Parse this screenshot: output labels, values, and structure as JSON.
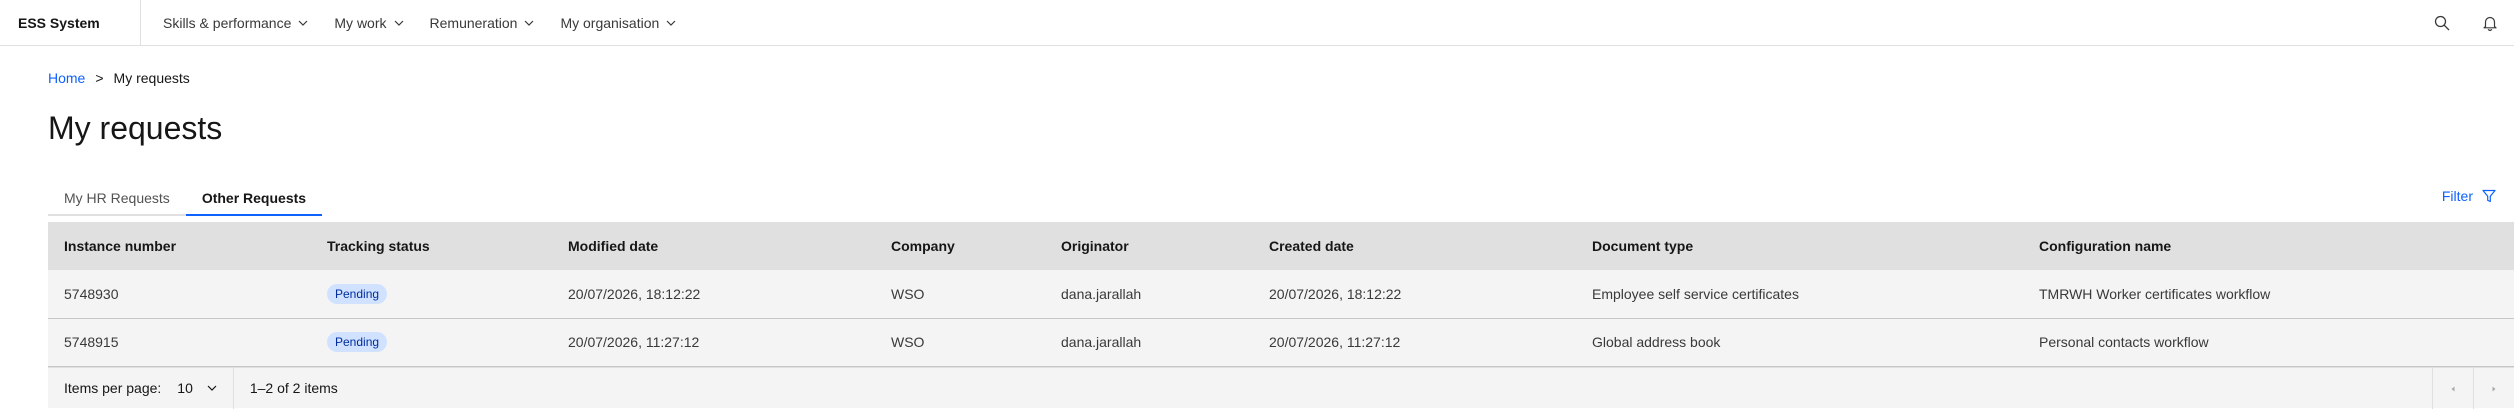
{
  "header": {
    "brand": "ESS System",
    "nav": [
      {
        "label": "Skills & performance"
      },
      {
        "label": "My work"
      },
      {
        "label": "Remuneration"
      },
      {
        "label": "My organisation"
      }
    ],
    "icons": {
      "search": "search-icon",
      "notifications": "bell-icon"
    }
  },
  "breadcrumb": {
    "home": "Home",
    "separator": ">",
    "current": "My requests"
  },
  "page": {
    "title": "My requests"
  },
  "tabs": [
    {
      "label": "My HR Requests",
      "active": false
    },
    {
      "label": "Other Requests",
      "active": true
    }
  ],
  "filter": {
    "label": "Filter"
  },
  "table": {
    "columns": [
      "Instance number",
      "Tracking status",
      "Modified date",
      "Company",
      "Originator",
      "Created date",
      "Document type",
      "Configuration name"
    ],
    "rows": [
      {
        "instance": "5748930",
        "status": "Pending",
        "modified": "20/07/2026, 18:12:22",
        "company": "WSO",
        "originator": "dana.jarallah",
        "created": "20/07/2026, 18:12:22",
        "doctype": "Employee self service certificates",
        "config": "TMRWH Worker certificates workflow"
      },
      {
        "instance": "5748915",
        "status": "Pending",
        "modified": "20/07/2026, 11:27:12",
        "company": "WSO",
        "originator": "dana.jarallah",
        "created": "20/07/2026, 11:27:12",
        "doctype": "Global address book",
        "config": "Personal contacts workflow"
      }
    ]
  },
  "pagination": {
    "items_per_page_label": "Items per page:",
    "items_per_page": "10",
    "range": "1–2 of 2 items"
  },
  "colors": {
    "accent": "#0f62fe",
    "badge_bg": "#d0e2ff",
    "badge_text": "#002d9c"
  }
}
